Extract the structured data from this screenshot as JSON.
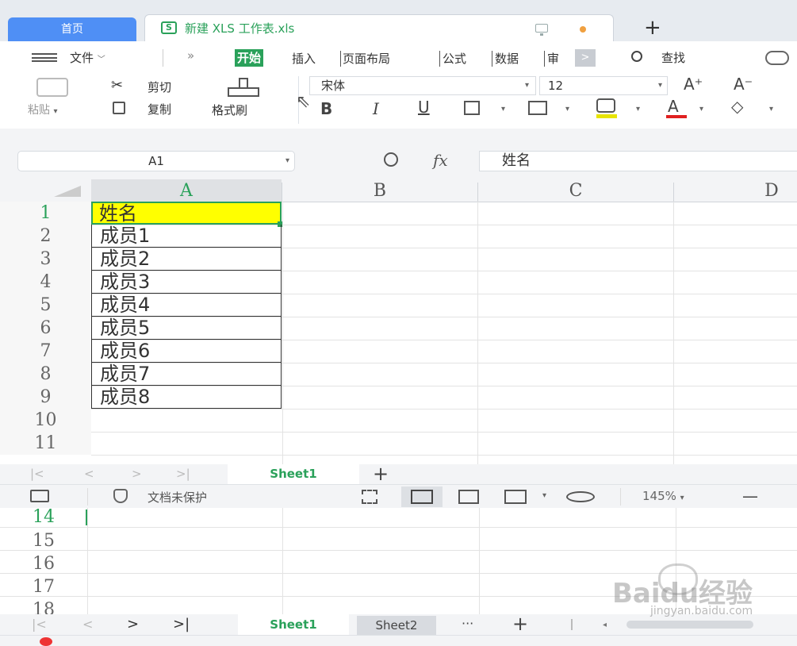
{
  "tabs": {
    "home": "首页",
    "document": "新建 XLS 工作表.xls",
    "new_tab": "+"
  },
  "menu": {
    "file": "文件",
    "more": "»",
    "items": [
      "开始",
      "插入",
      "页面布局",
      "公式",
      "数据",
      "审"
    ],
    "scroll": ">",
    "search": "查找"
  },
  "toolbar": {
    "paste": "粘贴",
    "cut": "剪切",
    "copy": "复制",
    "format_painter": "格式刷",
    "font_name": "宋体",
    "font_size": "12",
    "grow": "A⁺",
    "shrink": "A⁻",
    "bold": "B",
    "italic": "I",
    "underline": "U"
  },
  "formula_bar": {
    "cell_ref": "A1",
    "fx": "fx",
    "value": "姓名"
  },
  "columns": [
    "A",
    "B",
    "C",
    "D"
  ],
  "rows": [
    "1",
    "2",
    "3",
    "4",
    "5",
    "6",
    "7",
    "8",
    "9",
    "10",
    "11"
  ],
  "cells": {
    "A": [
      "姓名",
      "成员1",
      "成员2",
      "成员3",
      "成员4",
      "成员5",
      "成员6",
      "成员7",
      "成员8"
    ]
  },
  "sheetbar": {
    "sheet1": "Sheet1",
    "add": "+"
  },
  "status": {
    "protect": "文档未保护",
    "zoom": "145%",
    "minus": "—"
  },
  "rows2": [
    "14",
    "15",
    "16",
    "17",
    "18"
  ],
  "sheetbar2": {
    "sheet1": "Sheet1",
    "sheet2": "Sheet2",
    "more": "···",
    "add": "+"
  },
  "watermark": {
    "brand": "Baidu经验",
    "url": "jingyan.baidu.com"
  },
  "colors": {
    "accent": "#2aa15a",
    "home_tab": "#4f8ff5",
    "highlight": "#ffff00"
  }
}
